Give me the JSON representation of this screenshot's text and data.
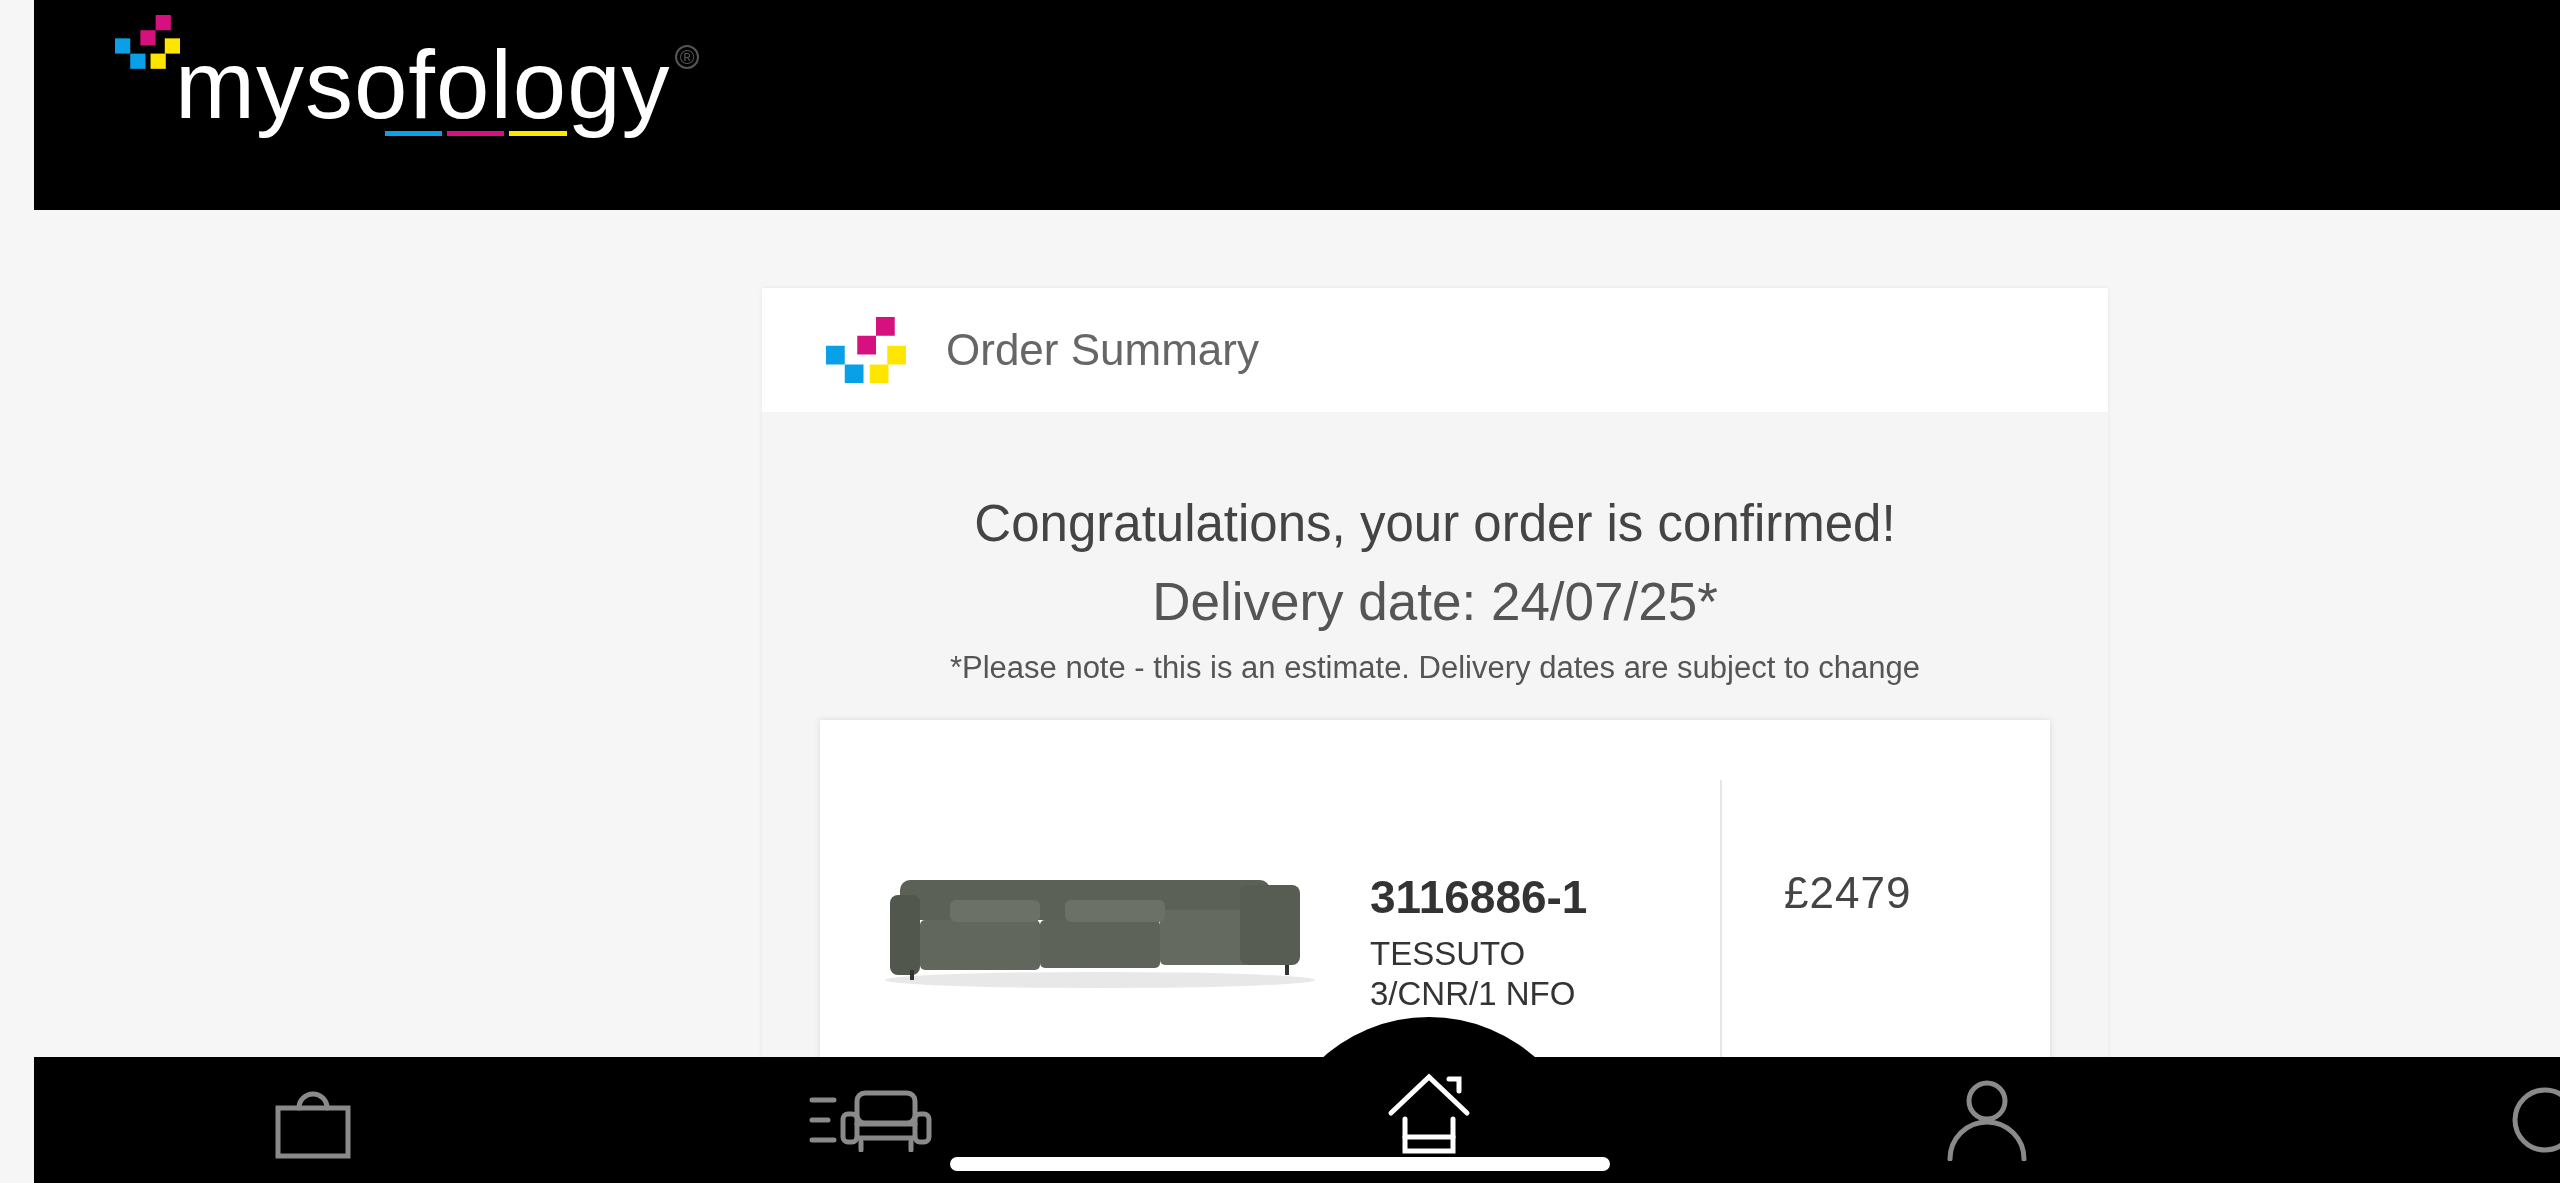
{
  "header": {
    "logo": {
      "wordmark": "mysofology",
      "registered": "®"
    }
  },
  "order_summary": {
    "title": "Order Summary",
    "heading": "Congratulations, your order is confirmed!",
    "delivery_date": "Delivery date: 24/07/25*",
    "note": "*Please note - this is an estimate. Delivery dates are subject to change",
    "items": [
      {
        "code": "3116886-1",
        "description": "TESSUTO 3/CNR/1 NFO",
        "price": "£2479"
      }
    ]
  },
  "bottom_nav": {
    "items": [
      {
        "kind": "bag",
        "selected": false
      },
      {
        "kind": "sofa",
        "selected": false
      },
      {
        "kind": "home",
        "selected": true
      },
      {
        "kind": "person",
        "selected": false
      },
      {
        "kind": "circle",
        "selected": false
      }
    ]
  }
}
